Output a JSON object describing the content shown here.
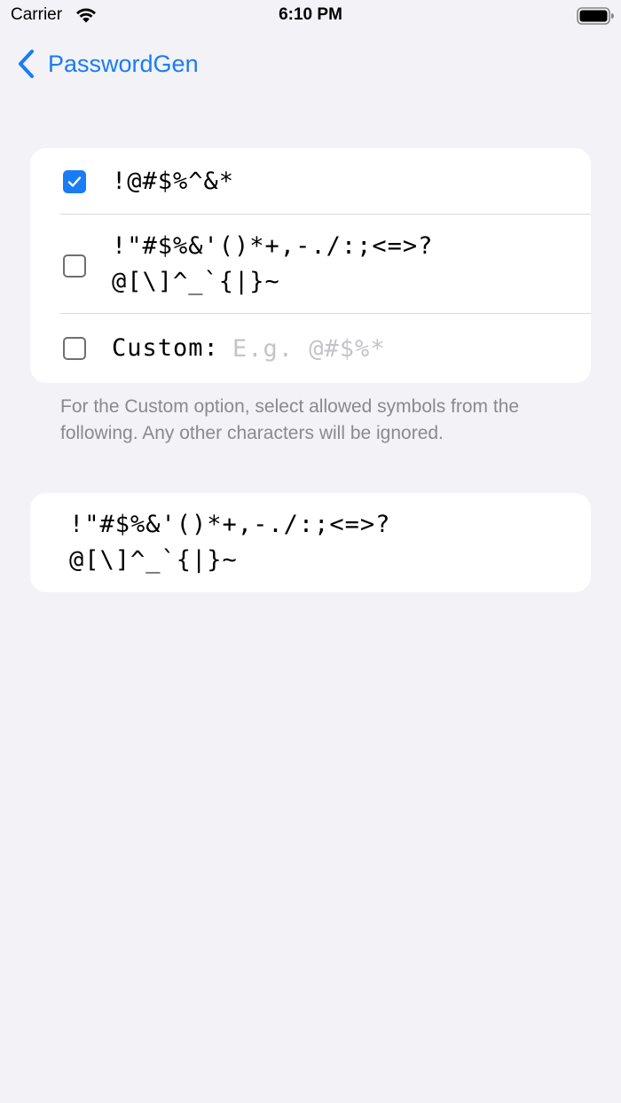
{
  "status_bar": {
    "carrier": "Carrier",
    "time": "6:10 PM",
    "icons": [
      "wifi-icon",
      "battery-icon"
    ]
  },
  "nav": {
    "back_label": "PasswordGen",
    "back_icon": "chevron-left-icon"
  },
  "colors": {
    "accent": "#1a7cf5",
    "background": "#f2f2f7",
    "card": "#ffffff",
    "secondary_text": "#8a8a8e",
    "placeholder": "#c4c4c8"
  },
  "options": [
    {
      "checked": true,
      "line1": "!@#$%^&*",
      "line2": ""
    },
    {
      "checked": false,
      "line1": "!\"#$%&'()*+,-./:;<=>?",
      "line2": "@[\\]^_`{|}~"
    },
    {
      "checked": false,
      "label": "Custom:",
      "placeholder": "E.g. @#$%*",
      "value": ""
    }
  ],
  "footer": "For the Custom option, select allowed symbols from the following. Any other characters will be ignored.",
  "allowed_symbols": {
    "line1": "!\"#$%&'()*+,-./:;<=>?",
    "line2": "@[\\]^_`{|}~"
  }
}
